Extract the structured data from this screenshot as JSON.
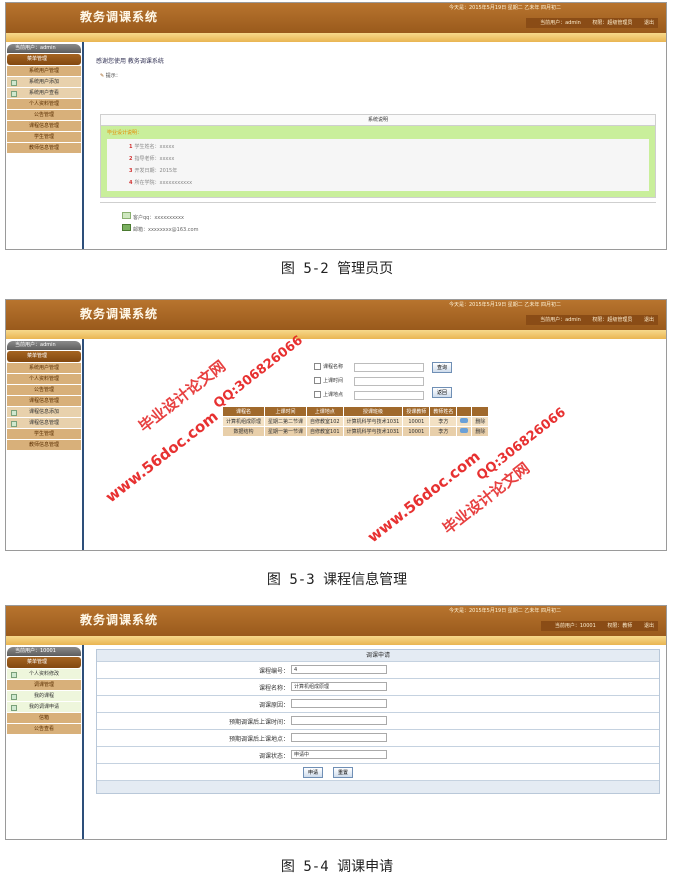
{
  "app_title": "教务调课系统",
  "shot1": {
    "today": "今天是：2015年5月19日 星期二 乙未年 四月初二",
    "current_user": "当前用户：admin",
    "role": "权限：超级管理员",
    "logout": "退出",
    "sidebar_user": "当前用户：admin",
    "sidebar_section": "菜单管理",
    "sidebar_items": [
      "系统用户管理",
      "系统用户添加",
      "系统用户查看",
      "个人资料管理",
      "公告管理",
      "课程信息管理",
      "学生管理",
      "教师信息管理"
    ],
    "welcome": "感谢您使用 教务调课系统",
    "tip": "提示：",
    "box_title": "系统说明",
    "design_title": "毕业设计说明：",
    "design_items": [
      {
        "num": "1",
        "text": "学生姓名：xxxxx"
      },
      {
        "num": "2",
        "text": "指导老师：xxxxx"
      },
      {
        "num": "3",
        "text": "开发日期：2015年"
      },
      {
        "num": "4",
        "text": "所在学院：xxxxxxxxxxx"
      }
    ],
    "qq": "客户qq：xxxxxxxxxx",
    "email": "邮箱：xxxxxxxx@163.com"
  },
  "caption1": "图 5-2 管理员页",
  "shot2": {
    "today": "今天是：2015年5月19日 星期二 乙未年 四月初二",
    "current_user": "当前用户：admin",
    "role": "权限：超级管理员",
    "logout": "退出",
    "sidebar_user": "当前用户：admin",
    "sidebar_section": "菜单管理",
    "sidebar_items": [
      "系统用户管理",
      "个人资料管理",
      "公告管理",
      "课程信息管理",
      "课程信息添加",
      "课程信息管理",
      "学生管理",
      "教师信息管理"
    ],
    "search_labels": [
      "课程名称",
      "上课时间",
      "上课地点"
    ],
    "query_button": "查询",
    "back_button": "返回",
    "table_headers": [
      "课程名",
      "上课时间",
      "上课地点",
      "授课班级",
      "授课教师",
      "教师姓名",
      "",
      ""
    ],
    "table_rows": [
      [
        "计算机组成原理",
        "星期二第二节课",
        "自修教室102",
        "计算机科学与技术1031",
        "10001",
        "李方",
        "",
        "删除"
      ],
      [
        "数据结构",
        "星期一第一节课",
        "自修教室101",
        "计算机科学与技术1031",
        "10001",
        "李方",
        "",
        "删除"
      ]
    ],
    "watermarks": [
      "毕业设计论文网",
      "QQ:306826066",
      "www.56doc.com",
      "www.56doc.com",
      "毕业设计论文网",
      "QQ:306826066"
    ]
  },
  "caption2": "图 5-3 课程信息管理",
  "shot3": {
    "today": "今天是：2015年5月19日 星期二 乙未年 四月初二",
    "current_user": "当前用户：10001",
    "role": "权限：教师",
    "logout": "退出",
    "sidebar_user": "当前用户：10001",
    "sidebar_section": "菜单管理",
    "sidebar_items": [
      "个人资料修改",
      "调课管理",
      "我的课程",
      "我的调课申请",
      "信箱",
      "公告查看"
    ],
    "form_title": "调课申请",
    "fields": [
      {
        "label": "课程编号：",
        "value": "4"
      },
      {
        "label": "课程名称：",
        "value": "计算机组成原理"
      },
      {
        "label": "调课原因：",
        "value": ""
      },
      {
        "label": "预期调课后上课时间：",
        "value": ""
      },
      {
        "label": "预期调课后上课地点：",
        "value": ""
      },
      {
        "label": "调课状态：",
        "value": "申请中"
      }
    ],
    "submit_button": "申请",
    "reset_button": "重置"
  },
  "caption3": "图 5-4 调课申请"
}
